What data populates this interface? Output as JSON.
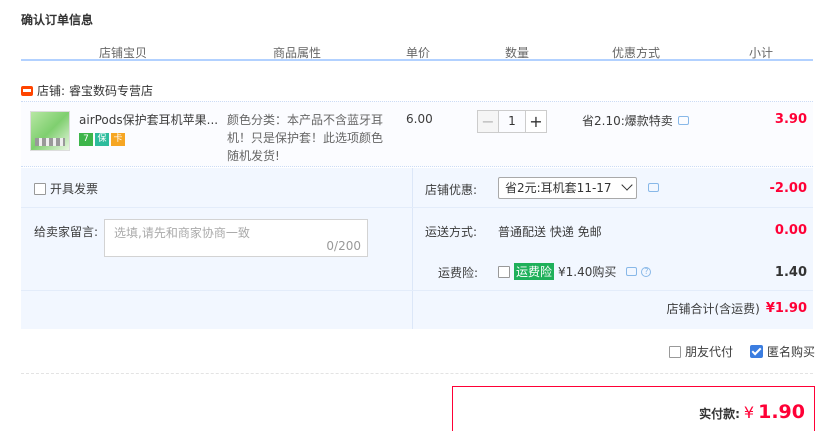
{
  "page_title": "确认订单信息",
  "headers": [
    "店铺宝贝",
    "商品属性",
    "单价",
    "数量",
    "优惠方式",
    "小计"
  ],
  "shop": {
    "prefix": "店铺:",
    "name": "睿宝数码专营店"
  },
  "item": {
    "name": "airPods保护套耳机苹果...",
    "attributes": "颜色分类：本产品不含蓝牙耳机！只是保护套！此选项颜色随机发货!",
    "price": "6.00",
    "minus": "−",
    "quantity": "1",
    "plus": "+",
    "discount": "省2.10:爆款特卖",
    "subtotal": "3.90",
    "badges": [
      "7",
      "保",
      "卡"
    ]
  },
  "invoice": {
    "label": "开具发票"
  },
  "message": {
    "label": "给卖家留言:",
    "placeholder": "选填,请先和商家协商一致",
    "count": "0/200"
  },
  "shop_discount": {
    "label": "店铺优惠:",
    "selected": "省2元:耳机套11-17",
    "amount": "-2.00"
  },
  "shipping": {
    "label": "运送方式:",
    "value": "普通配送 快递 免邮",
    "amount": "0.00"
  },
  "insurance": {
    "label": "运费险:",
    "tag": "运费险",
    "text": "¥1.40购买",
    "help": "?",
    "amount": "1.40"
  },
  "shop_total": {
    "label": "店铺合计(含运费)",
    "value": "¥1.90"
  },
  "friend_pay": {
    "label": "朋友代付",
    "checked": false
  },
  "anonymous": {
    "label": "匿名购买",
    "checked": true
  },
  "payment": {
    "label": "实付款:",
    "currency": "¥",
    "value": "1.90"
  },
  "colors": {
    "accent": "#ff0036",
    "border_blue": "#b2d1ff",
    "panel_bg": "#f2f7ff",
    "checkbox_blue": "#3b7de0"
  }
}
